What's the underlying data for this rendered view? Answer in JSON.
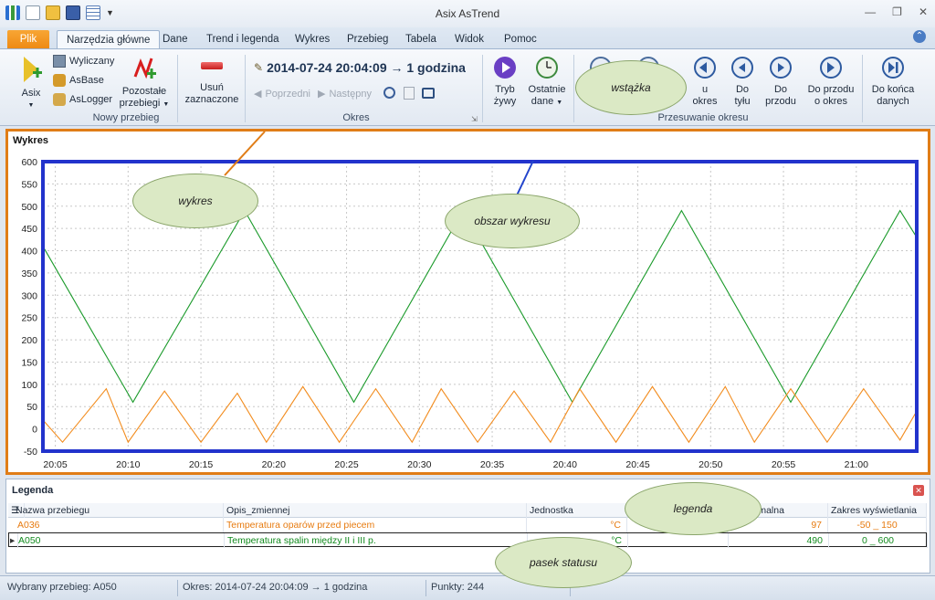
{
  "window": {
    "title": "Asix AsTrend"
  },
  "tabs": [
    "Plik",
    "Narzędzia główne",
    "Dane",
    "Trend i legenda",
    "Wykres",
    "Przebieg",
    "Tabela",
    "Widok",
    "Pomoc"
  ],
  "ribbon": {
    "asix": "Asix",
    "wyliczany": "Wyliczany",
    "asbase": "AsBase",
    "aslogger": "AsLogger",
    "pozostale": "Pozostałe",
    "pozostale2": "przebiegi",
    "nowy_przebieg": "Nowy przebieg",
    "usun": "Usuń",
    "usun2": "zaznaczone",
    "period": "2014-07-24  20:04:09 → 1 godzina",
    "poprzedni": "Poprzedni",
    "nastepny": "Następny",
    "okres": "Okres",
    "tryb": "Tryb",
    "tryb2": "żywy",
    "ostatnie": "Ostatnie",
    "ostatnie2": "dane",
    "dopoczatku_frag": "u",
    "dopoczatku_frag2": "okres",
    "do_tylu": "Do",
    "do_tylu2": "tyłu",
    "do_przodu": "Do",
    "do_przodu2": "przodu",
    "do_przodu_okres": "Do przodu",
    "do_przodu_okres2": "o okres",
    "do_konca": "Do końca",
    "do_konca2": "danych",
    "przesuwanie": "Przesuwanie okresu"
  },
  "chart": {
    "panel_title": "Wykres"
  },
  "chart_data": {
    "type": "line",
    "x_ticks": [
      "20:05",
      "20:10",
      "20:15",
      "20:20",
      "20:25",
      "20:30",
      "20:35",
      "20:40",
      "20:45",
      "20:50",
      "20:55",
      "21:00"
    ],
    "ylim": [
      -50,
      600
    ],
    "y_ticks": [
      600,
      550,
      500,
      450,
      400,
      350,
      300,
      250,
      200,
      150,
      100,
      50,
      0,
      -50
    ],
    "grid": true,
    "series": [
      {
        "name": "A050",
        "color": "#1a9a2a",
        "x": [
          "20:04:09",
          "20:10:20",
          "20:18:00",
          "20:25:30",
          "20:33:00",
          "20:40:30",
          "20:48:00",
          "20:55:30",
          "21:03:00",
          "21:04:09"
        ],
        "y": [
          410,
          60,
          490,
          60,
          490,
          60,
          490,
          60,
          490,
          430
        ]
      },
      {
        "name": "A036",
        "color": "#f28c1e",
        "x": [
          "20:04:09",
          "20:05:30",
          "20:08:30",
          "20:10:00",
          "20:12:30",
          "20:15:00",
          "20:17:30",
          "20:19:30",
          "20:22:00",
          "20:24:30",
          "20:27:00",
          "20:29:30",
          "20:31:30",
          "20:34:00",
          "20:36:30",
          "20:39:00",
          "20:41:00",
          "20:43:30",
          "20:46:00",
          "20:48:30",
          "20:51:00",
          "20:53:00",
          "20:55:30",
          "20:58:00",
          "21:00:30",
          "21:03:00",
          "21:04:09"
        ],
        "y": [
          20,
          -30,
          90,
          -30,
          85,
          -30,
          80,
          -30,
          95,
          -30,
          90,
          -30,
          90,
          -30,
          85,
          -30,
          90,
          -30,
          95,
          -30,
          95,
          -30,
          90,
          -30,
          90,
          -25,
          40
        ]
      }
    ]
  },
  "legend": {
    "title": "Legenda",
    "headers": [
      "Nazwa przebiegu",
      "Opis_zmiennej",
      "Jednostka",
      "",
      "maksymalna",
      "Zakres wyświetlania"
    ],
    "rows": [
      {
        "name": "A036",
        "desc": "Temperatura oparów przed piecem",
        "unit": "°C",
        "min": "",
        "max": "97",
        "range": "-50 _ 150",
        "color": "#e77b10"
      },
      {
        "name": "A050",
        "desc": "Temperatura spalin między II i III p.",
        "unit": "°C",
        "min": "",
        "max": "490",
        "range": "0 _ 600",
        "color": "#128a1e"
      }
    ]
  },
  "status": {
    "selected": "Wybrany przebieg: A050",
    "period": "Okres: 2014-07-24 20:04:09 → 1 godzina",
    "points": "Punkty: 244"
  },
  "callouts": {
    "wstazka": "wstążka",
    "wykres": "wykres",
    "obszar": "obszar wykresu",
    "legenda": "legenda",
    "pasek": "pasek statusu"
  }
}
